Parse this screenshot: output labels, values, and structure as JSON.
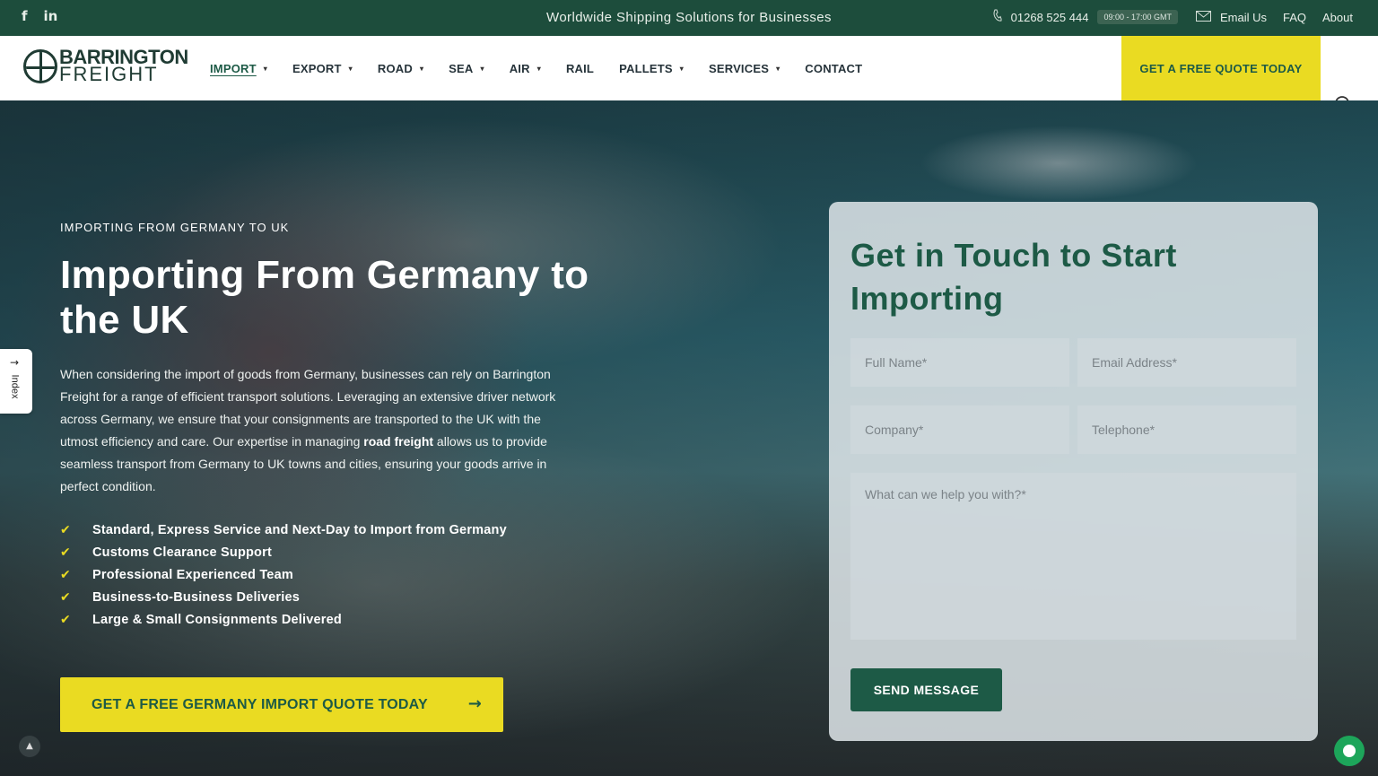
{
  "topbar": {
    "social": {
      "facebook": "f",
      "linkedin": "in"
    },
    "tagline": "Worldwide Shipping Solutions for Businesses",
    "phone": "01268 525 444",
    "hours": "09:00 - 17:00 GMT",
    "email_label": "Email Us",
    "faq_label": "FAQ",
    "about_label": "About",
    "icons": {
      "phone": "phone-icon",
      "email": "envelope-icon"
    }
  },
  "brand": {
    "line1": "BARRINGTON",
    "line2": "FREIGHT"
  },
  "nav": {
    "items": [
      {
        "label": "IMPORT",
        "caret": "▾"
      },
      {
        "label": "EXPORT",
        "caret": "▾"
      },
      {
        "label": "ROAD",
        "caret": "▾"
      },
      {
        "label": "SEA",
        "caret": "▾"
      },
      {
        "label": "AIR",
        "caret": "▾"
      },
      {
        "label": "RAIL"
      },
      {
        "label": "PALLETS",
        "caret": "▾"
      },
      {
        "label": "SERVICES",
        "caret": "▾"
      },
      {
        "label": "CONTACT"
      }
    ],
    "quote_button": "GET A FREE QUOTE TODAY"
  },
  "hero": {
    "eyebrow": "IMPORTING FROM GERMANY TO UK",
    "title": "Importing From Germany to the UK",
    "body_before": "When considering the import of goods from Germany, businesses can rely on Barrington Freight for a range of efficient transport solutions. Leveraging an extensive driver network across Germany, we ensure that your consignments are transported to the UK with the utmost efficiency and care. Our expertise in managing ",
    "body_bold": "road freight",
    "body_after": " allows us to provide seamless transport from Germany to UK towns and cities, ensuring your goods arrive in perfect condition.",
    "checklist": [
      "Standard, Express Service and Next-Day to Import from Germany",
      "Customs Clearance Support",
      "Professional Experienced Team",
      "Business-to-Business Deliveries",
      "Large & Small Consignments Delivered"
    ],
    "cta_label": "GET A FREE GERMANY IMPORT QUOTE TODAY"
  },
  "form": {
    "title": "Get in Touch to Start Importing",
    "full_name_placeholder": "Full Name*",
    "email_placeholder": "Email Address*",
    "company_placeholder": "Company*",
    "telephone_placeholder": "Telephone*",
    "message_placeholder": "What can we help you with?*",
    "submit_label": "SEND MESSAGE"
  },
  "side_tab": {
    "label": "Index",
    "arrow": "→"
  },
  "colors": {
    "dark_green": "#1d4d3c",
    "brand_green": "#1d5a46",
    "accent_yellow": "#eadb22"
  }
}
